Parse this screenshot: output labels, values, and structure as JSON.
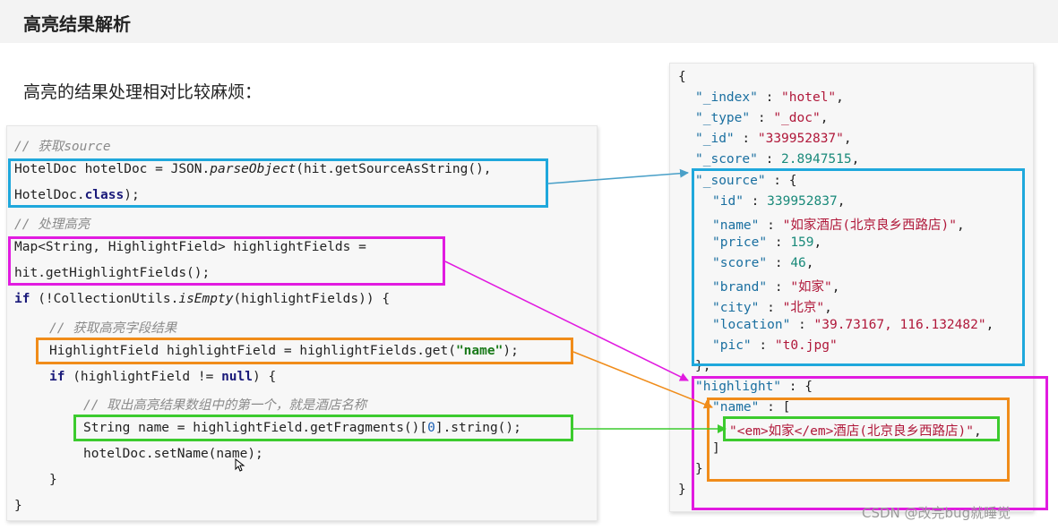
{
  "slide": {
    "title": "高亮结果解析",
    "subtitle": "高亮的结果处理相对比较麻烦："
  },
  "code": {
    "c1": "// 获取source",
    "l2_pre": "HotelDoc hotelDoc = JSON.",
    "l2_method": "parseObject",
    "l2_post": "(hit.getSourceAsString(),",
    "l3_pre": "HotelDoc.",
    "l3_kw": "class",
    "l3_post": ");",
    "c4": "// 处理高亮",
    "l5": "Map<String, HighlightField> highlightFields =",
    "l6": "hit.getHighlightFields();",
    "l7_kw": "if",
    "l7_pre": " (!CollectionUtils.",
    "l7_method": "isEmpty",
    "l7_post": "(highlightFields)) {",
    "c8": "// 获取高亮字段结果",
    "l9_pre": "HighlightField highlightField = highlightFields.get(",
    "l9_str": "\"name\"",
    "l9_post": ");",
    "l10_kw": "if",
    "l10_pre": " (highlightField != ",
    "l10_null": "null",
    "l10_post": ") {",
    "c11": "// 取出高亮结果数组中的第一个，就是酒店名称",
    "l12_pre": "String name = highlightField.getFragments()[",
    "l12_num": "0",
    "l12_post": "].string();",
    "l13": "hotelDoc.setName(name);",
    "l14": "}",
    "l15": "}"
  },
  "json": {
    "open": "{",
    "index_key": "\"_index\"",
    "index_val": "\"hotel\"",
    "type_key": "\"_type\"",
    "type_val": "\"_doc\"",
    "id_key": "\"_id\"",
    "id_val": "\"339952837\"",
    "score_key": "\"_score\"",
    "score_val": "2.8947515",
    "source_key": "\"_source\"",
    "s_id_key": "\"id\"",
    "s_id_val": "339952837",
    "s_name_key": "\"name\"",
    "s_name_val": "\"如家酒店(北京良乡西路店)\"",
    "s_price_key": "\"price\"",
    "s_price_val": "159",
    "s_score_key": "\"score\"",
    "s_score_val": "46",
    "s_brand_key": "\"brand\"",
    "s_brand_val": "\"如家\"",
    "s_city_key": "\"city\"",
    "s_city_val": "\"北京\"",
    "s_location_key": "\"location\"",
    "s_location_val": "\"39.73167, 116.132482\"",
    "s_pic_key": "\"pic\"",
    "s_pic_val": "\"t0.jpg\"",
    "source_close": "},",
    "highlight_key": "\"highlight\"",
    "h_name_key": "\"name\"",
    "h_name_val": "\"<em>如家</em>酒店(北京良乡西路店)\"",
    "arr_close": "]",
    "h_close": "}",
    "close": "}"
  },
  "watermark": "CSDN @改完bug就睡觉",
  "colors": {
    "blue_box": "#1fa8dc",
    "magenta_box": "#e11be0",
    "orange_box": "#f08c1a",
    "green_box": "#3ccb2e"
  }
}
